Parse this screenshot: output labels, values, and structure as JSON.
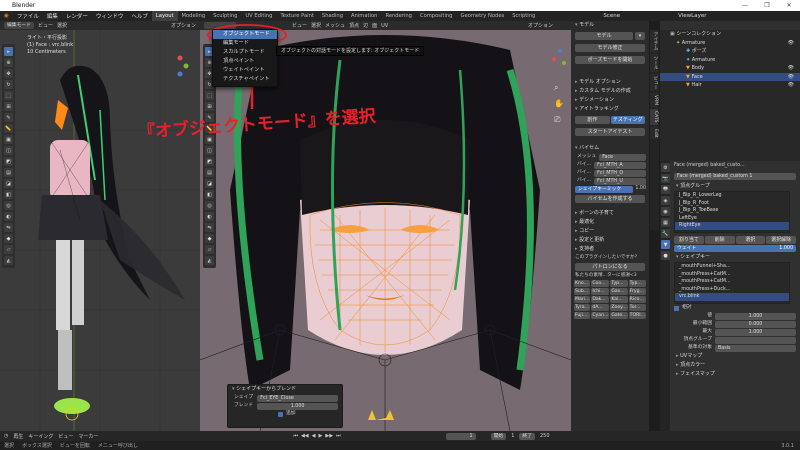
{
  "app": {
    "title": "Blender",
    "window_controls": [
      "—",
      "❐",
      "✕"
    ]
  },
  "menubar": {
    "items": [
      "ファイル",
      "編集",
      "レンダー",
      "ウィンドウ",
      "ヘルプ"
    ],
    "workspaces": [
      "Layout",
      "Modeling",
      "Sculpting",
      "UV Editing",
      "Texture Paint",
      "Shading",
      "Animation",
      "Rendering",
      "Compositing",
      "Geometry Nodes",
      "Scripting"
    ],
    "active_workspace": "Layout",
    "scene_label": "Scene",
    "viewlayer_label": "ViewLayer"
  },
  "left_viewport": {
    "mode": "編集モード",
    "menus": [
      "ビュー",
      "選択"
    ],
    "options_label": "オプション",
    "overlay_lines": [
      "ライト・平行投影",
      "(1) Face : vrc.blink",
      "10 Centimeters"
    ]
  },
  "main_viewport": {
    "mode_button": "オブジェクトモード",
    "menus": [
      "ビュー",
      "選択",
      "メッシュ",
      "頂点",
      "辺",
      "面",
      "UV"
    ],
    "options_label": "オプション",
    "mode_menu": {
      "items": [
        "オブジェクトモード",
        "編集モード",
        "スカルプトモード",
        "頂点ペイント",
        "ウェイトペイント",
        "テクスチャペイント"
      ],
      "highlighted": 0
    },
    "tooltip": "オブジェクトの対話モードを設定します: オブジェクトモード",
    "annotation": "『オブジェクトモード』を選択",
    "accent_red": "#e8202a"
  },
  "shapekey_popup": {
    "title": "シェイプキーからブレンド",
    "shape_label": "シェイプ",
    "shape_value": "Fcl_EYE_Close",
    "blend_label": "ブレンド",
    "blend_value": "1.000",
    "add_label": "追加"
  },
  "npanel": {
    "tabs": [
      "アイテム",
      "ツール",
      "ビュー",
      "VRM",
      "CATS",
      "Edit"
    ],
    "sections": {
      "model_header": "モデル",
      "model_label": "モデル",
      "model_fix_button": "モデル修正",
      "pose_mode_button": "ポーズモードを開始",
      "model_options": "モデル オプション",
      "custom_model": "カスタム モデルの作成",
      "decimation": "デシメーション",
      "eye_tracking": "アイトラッキング",
      "eye_tabs": [
        "創作",
        "テスティング"
      ],
      "start_eye_test": "スタートアイテスト",
      "visemes": "バイセム",
      "mesh_label": "メッシュ",
      "mesh_value": "Face",
      "viseme_rows": [
        {
          "label": "バイ...",
          "value": "Fcl_MTH_A"
        },
        {
          "label": "バイ...",
          "value": "Fcl_MTH_O"
        },
        {
          "label": "バイ...",
          "value": "Fcl_MTH_U"
        }
      ],
      "shapekey_mix_label": "シェイプキーミック",
      "shapekey_mix_value": "1.00",
      "create_viseme_button": "バイセムを作成する",
      "bone_parent": "ボーンの子育て",
      "optimize": "最適化",
      "copy": "コピー",
      "update_settings": "設定と更新",
      "support": "支持者",
      "plugin_question": "このプラグインしたいですか?",
      "patreon_button": "パトロンになる",
      "supporters_line": "私たちの素晴...ターに感謝<3"
    },
    "supporters": [
      "Kno...",
      "Coo...",
      "Typ...",
      "Typ...",
      "Sub...",
      "Ichi...",
      "Gas...",
      "Fryg...",
      "Mari...",
      "Dak...",
      "Kai...",
      "Rico...",
      "Tyra...",
      "dA...",
      "Zoey...",
      "Tor...",
      "Fuji...",
      "Cyan...",
      "Gato...",
      "TORI..."
    ]
  },
  "outliner": {
    "title": "シーンコレクション",
    "rows": [
      {
        "name": "Armature",
        "indent": 1,
        "icon": "armature"
      },
      {
        "name": "ポーズ",
        "indent": 2,
        "icon": "pose"
      },
      {
        "name": "Armature",
        "indent": 2,
        "icon": "armature-data"
      },
      {
        "name": "Body",
        "indent": 2,
        "icon": "mesh"
      },
      {
        "name": "Face",
        "indent": 2,
        "icon": "mesh",
        "selected": true
      },
      {
        "name": "Hair",
        "indent": 2,
        "icon": "mesh"
      }
    ]
  },
  "properties": {
    "breadcrumb": "Face (merged) baked_custo...",
    "object_name": "Face (merged) baked_custom 1",
    "vertex_groups_header": "頂点グループ",
    "vertex_groups": [
      "J_Bip_R_LowerLeg",
      "J_Bip_R_Foot",
      "J_Bip_R_ToeBase",
      "LeftEye",
      "RightEye"
    ],
    "vg_buttons": [
      "割り当て",
      "削除",
      "選択",
      "選択解除"
    ],
    "weight_label": "ウェイト",
    "weight_value": "1.000",
    "shapekeys_header": "シェイプキー",
    "shapekeys": [
      "_mouthFunnel+Sha...",
      "_mouthPress+CatM...",
      "_mouthPress+CatM...",
      "_mouthPress+Duck...",
      "vrc.blink"
    ],
    "relative_label": "相対",
    "value_label": "値",
    "value_value": "1.000",
    "min_label": "最小範囲",
    "min_value": "0.000",
    "max_label": "最大",
    "max_value": "1.000",
    "vertex_group_label": "頂点グループ",
    "relative_to_label": "基準の対象",
    "relative_to_value": "Basis",
    "uvmap_header": "UVマップ",
    "vertex_color_header": "頂点カラー",
    "face_maps_header": "フェイスマップ"
  },
  "timeline": {
    "items": [
      "再生",
      "キーイング",
      "ビュー",
      "マーカー"
    ],
    "current_frame": "1",
    "start_label": "開始",
    "start_value": "1",
    "end_label": "終了",
    "end_value": "250"
  },
  "statusbar": {
    "items": [
      "選択",
      "ボックス選択",
      "ビューを回転",
      "メニュー呼び出し"
    ],
    "version": "3.0.1"
  },
  "colors": {
    "accent_blue": "#4772b3",
    "panel": "#303030",
    "viewport": "#3b3b3b"
  }
}
